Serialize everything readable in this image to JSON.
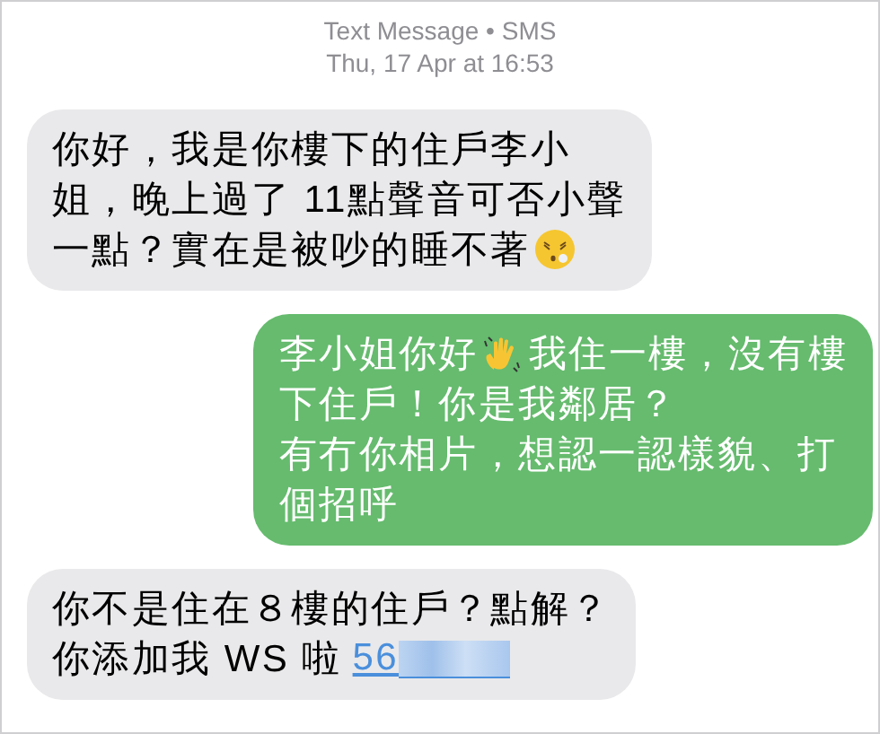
{
  "header": {
    "service": "Text Message • SMS",
    "timestamp": "Thu, 17 Apr at 16:53"
  },
  "messages": [
    {
      "kind": "received",
      "lines": [
        [
          {
            "kind": "text",
            "text": "你好，我是你樓下的住戶李小"
          }
        ],
        [
          {
            "kind": "text",
            "text": "姐，晚上過了 11點聲音可否小聲"
          }
        ],
        [
          {
            "kind": "text",
            "text": "一點？實在是被吵的睡不著"
          },
          {
            "kind": "face"
          }
        ]
      ]
    },
    {
      "kind": "sent",
      "lines": [
        [
          {
            "kind": "text",
            "text": "李小姐你好"
          },
          {
            "kind": "hand"
          },
          {
            "kind": "text",
            "text": "我住一樓，沒有樓"
          }
        ],
        [
          {
            "kind": "text",
            "text": "下住戶！你是我鄰居？"
          }
        ],
        [
          {
            "kind": "text",
            "text": "有冇你相片，想認一認樣貌、打"
          }
        ],
        [
          {
            "kind": "text",
            "text": "個招呼"
          }
        ]
      ]
    },
    {
      "kind": "received",
      "lines": [
        [
          {
            "kind": "text",
            "text": "你不是住在８樓的住戶？點解？"
          }
        ],
        [
          {
            "kind": "text",
            "text": "你添加我 WS 啦"
          },
          {
            "kind": "link",
            "text": "56"
          },
          {
            "kind": "redacted"
          }
        ]
      ]
    }
  ]
}
